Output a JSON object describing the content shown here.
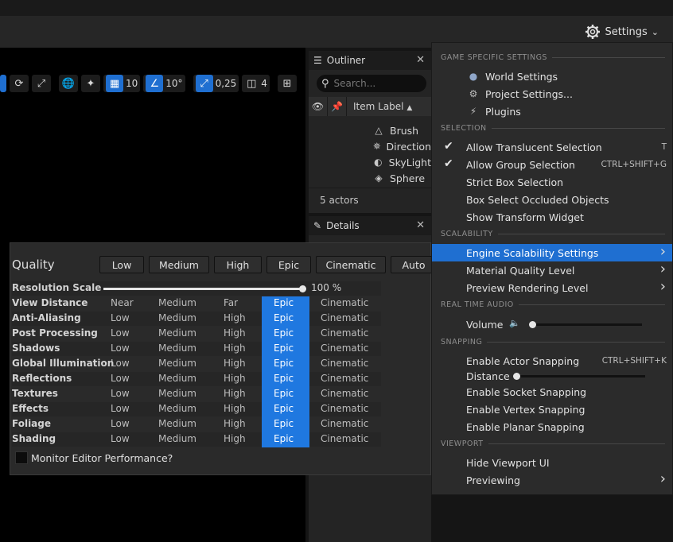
{
  "toolbar": {
    "settings_label": "Settings",
    "viewport": {
      "grid_snap_value": "10",
      "rotation_snap_value": "10°",
      "scale_snap_value": "0,25",
      "camera_speed_value": "4"
    }
  },
  "outliner": {
    "tab_label": "Outliner",
    "search_placeholder": "Search...",
    "column_label": "Item Label",
    "rows": [
      {
        "label": "Brush",
        "icon": "brush-icon"
      },
      {
        "label": "Direction",
        "icon": "directional-light-icon"
      },
      {
        "label": "SkyLight",
        "icon": "skylight-icon"
      },
      {
        "label": "Sphere",
        "icon": "cube-icon"
      }
    ],
    "footer": "5 actors"
  },
  "details": {
    "tab_label": "Details"
  },
  "scalability": {
    "title": "Quality",
    "presets": [
      "Low",
      "Medium",
      "High",
      "Epic",
      "Cinematic",
      "Auto"
    ],
    "resolution_scale": {
      "label": "Resolution Scale",
      "value": "100 %",
      "fraction": 1.0
    },
    "rows": [
      {
        "label": "View Distance",
        "levels": [
          "Near",
          "Medium",
          "Far",
          "Epic",
          "Cinematic"
        ]
      },
      {
        "label": "Anti-Aliasing",
        "levels": [
          "Low",
          "Medium",
          "High",
          "Epic",
          "Cinematic"
        ]
      },
      {
        "label": "Post Processing",
        "levels": [
          "Low",
          "Medium",
          "High",
          "Epic",
          "Cinematic"
        ]
      },
      {
        "label": "Shadows",
        "levels": [
          "Low",
          "Medium",
          "High",
          "Epic",
          "Cinematic"
        ]
      },
      {
        "label": "Global Illumination",
        "levels": [
          "Low",
          "Medium",
          "High",
          "Epic",
          "Cinematic"
        ]
      },
      {
        "label": "Reflections",
        "levels": [
          "Low",
          "Medium",
          "High",
          "Epic",
          "Cinematic"
        ]
      },
      {
        "label": "Textures",
        "levels": [
          "Low",
          "Medium",
          "High",
          "Epic",
          "Cinematic"
        ]
      },
      {
        "label": "Effects",
        "levels": [
          "Low",
          "Medium",
          "High",
          "Epic",
          "Cinematic"
        ]
      },
      {
        "label": "Foliage",
        "levels": [
          "Low",
          "Medium",
          "High",
          "Epic",
          "Cinematic"
        ]
      },
      {
        "label": "Shading",
        "levels": [
          "Low",
          "Medium",
          "High",
          "Epic",
          "Cinematic"
        ]
      }
    ],
    "selected_level": "Epic",
    "monitor_label": "Monitor Editor Performance?",
    "accent_color": "#1f78e0"
  },
  "menu": {
    "sections": {
      "game": "GAME SPECIFIC SETTINGS",
      "selection": "SELECTION",
      "scalability": "SCALABILITY",
      "audio": "REAL TIME AUDIO",
      "snapping": "SNAPPING",
      "viewport": "VIEWPORT"
    },
    "game_items": [
      {
        "label": "World Settings",
        "icon": "globe-icon"
      },
      {
        "label": "Project Settings...",
        "icon": "gears-icon"
      },
      {
        "label": "Plugins",
        "icon": "plug-icon"
      }
    ],
    "selection_items": [
      {
        "label": "Allow Translucent Selection",
        "checked": true,
        "shortcut": "T"
      },
      {
        "label": "Allow Group Selection",
        "checked": true,
        "shortcut": "CTRL+SHIFT+G"
      },
      {
        "label": "Strict Box Selection",
        "checked": false,
        "shortcut": ""
      },
      {
        "label": "Box Select Occluded Objects",
        "checked": false,
        "shortcut": ""
      },
      {
        "label": "Show Transform Widget",
        "checked": false,
        "shortcut": ""
      }
    ],
    "scalability_items": [
      {
        "label": "Engine Scalability Settings",
        "highlighted": true
      },
      {
        "label": "Material Quality Level",
        "highlighted": false
      },
      {
        "label": "Preview Rendering Level",
        "highlighted": false
      }
    ],
    "volume_label": "Volume",
    "volume_level": 0.0,
    "snapping_items": {
      "actor": "Enable Actor Snapping",
      "actor_shortcut": "CTRL+SHIFT+K",
      "distance": "Distance",
      "distance_level": 0.0,
      "socket": "Enable Socket Snapping",
      "vertex": "Enable Vertex Snapping",
      "planar": "Enable Planar Snapping"
    },
    "viewport_items": [
      {
        "label": "Hide Viewport UI",
        "submenu": false
      },
      {
        "label": "Previewing",
        "submenu": true
      }
    ],
    "highlight_color": "#1f6fd1"
  }
}
